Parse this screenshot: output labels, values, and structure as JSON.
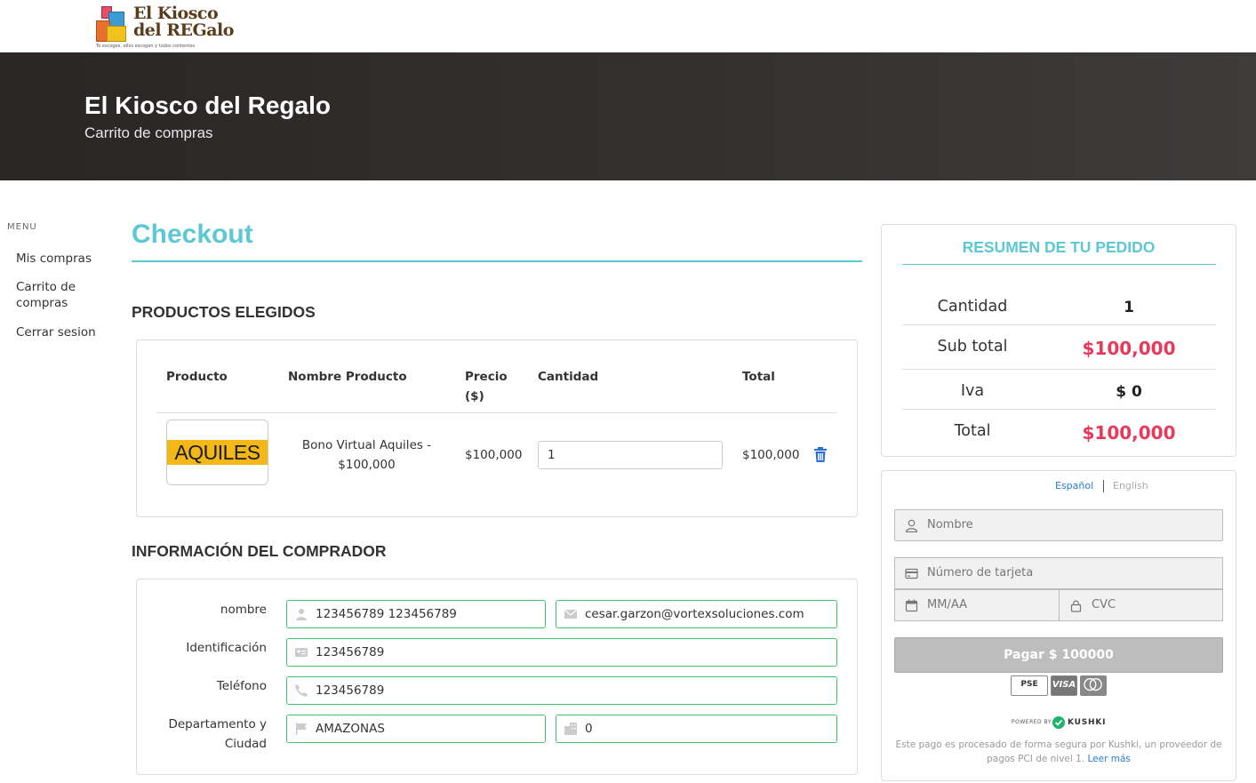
{
  "brand": {
    "logo_line1": "El Kiosco",
    "logo_line2": "del REGalo",
    "logo_tagline": "Tú escoges, ellos escogen y todos contentos."
  },
  "hero": {
    "title": "El Kiosco del Regalo",
    "subtitle": "Carrito de compras"
  },
  "menu": {
    "title": "MENU",
    "items": [
      {
        "label": "Mis compras"
      },
      {
        "label": "Carrito de compras"
      },
      {
        "label": "Cerrar sesion"
      }
    ]
  },
  "page": {
    "heading": "Checkout"
  },
  "products": {
    "section_title": "PRODUCTOS ELEGIDOS",
    "columns": [
      "Producto",
      "Nombre Producto",
      "Precio ($)",
      "Cantidad",
      "Total"
    ],
    "rows": [
      {
        "image_text": "AQUILES",
        "name": "Bono Virtual Aquiles - $100,000",
        "price": "$100,000",
        "quantity": "1",
        "total": "$100,000"
      }
    ]
  },
  "buyer": {
    "section_title": "INFORMACIÓN DEL COMPRADOR",
    "labels": {
      "nombre": "nombre",
      "identificacion": "Identificación",
      "telefono": "Teléfono",
      "departamento": "Departamento y Ciudad"
    },
    "values": {
      "nombre": "123456789 123456789",
      "email": "cesar.garzon@vortexsoluciones.com",
      "identificacion": "123456789",
      "telefono": "123456789",
      "departamento": "AMAZONAS",
      "ciudad": "0"
    }
  },
  "summary": {
    "title": "RESUMEN DE TU PEDIDO",
    "rows": [
      {
        "label": "Cantidad",
        "value": "1"
      },
      {
        "label": "Sub total",
        "value": "$100,000"
      },
      {
        "label": "Iva",
        "value": "$ 0"
      },
      {
        "label": "Total",
        "value": "$100,000"
      }
    ],
    "accent_color": "#e8395a"
  },
  "payment": {
    "lang_es": "Español",
    "lang_en": "English",
    "name_placeholder": "Nombre",
    "card_placeholder": "Número de tarjeta",
    "expiry_placeholder": "MM/AA",
    "cvc_placeholder": "CVC",
    "pay_button": "Pagar $ 100000",
    "card_brands": [
      "PSE",
      "VISA",
      "mastercard"
    ],
    "powered_by": "POWERED BY",
    "provider": "KUSHKI",
    "fine_print": "Este pago es procesado de forma segura por Kushki, un proveedor de pagos PCI de nivel 1.",
    "read_more": "Leer más"
  },
  "colors": {
    "accent_teal": "#5bc8d4",
    "field_border_green": "#3cc46a",
    "hero_bg": "#2f2b2b"
  }
}
